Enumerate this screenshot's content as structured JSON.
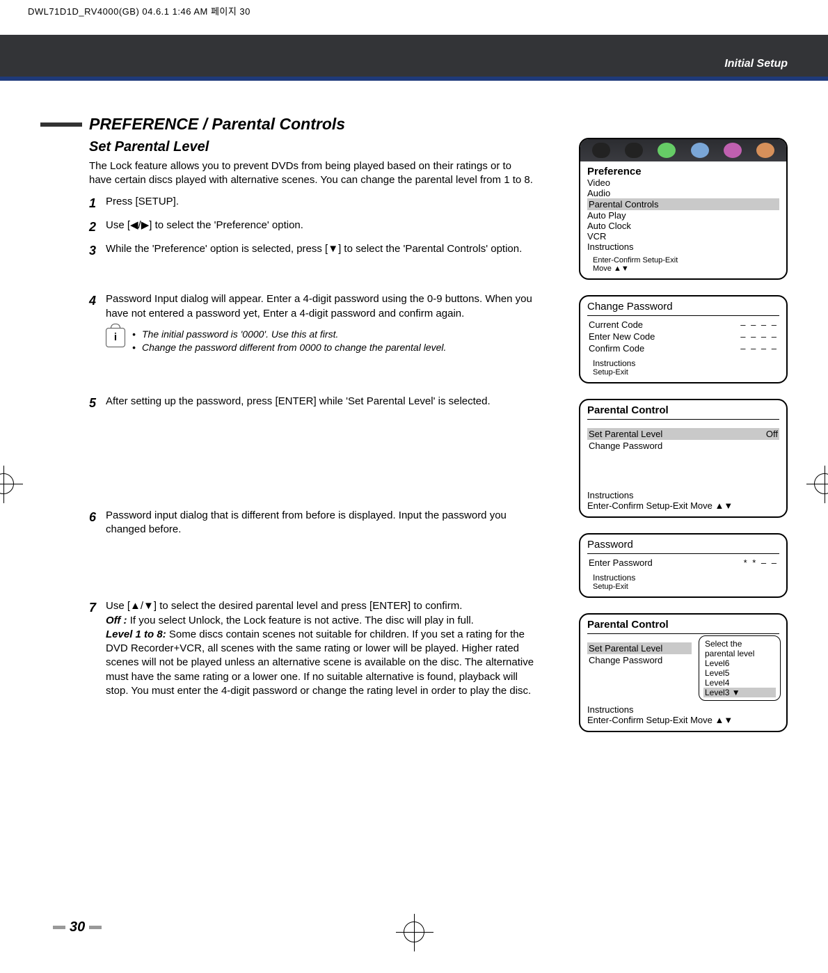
{
  "print_header": "DWL71D1D_RV4000(GB)   04.6.1  1:46 AM      페이지   30",
  "section_label": "Initial Setup",
  "heading": "PREFERENCE / Parental Controls",
  "sub_heading": "Set Parental Level",
  "intro": "The Lock feature allows you to prevent DVDs from being played based on their ratings or to have certain discs played with alternative scenes. You can change the parental level from 1 to 8.",
  "steps": {
    "s1": "Press [SETUP].",
    "s2": "Use [◀/▶] to select the 'Preference' option.",
    "s3": "While the 'Preference' option is selected, press [▼] to select the 'Parental Controls' option.",
    "s4": "Password Input dialog will appear. Enter a 4-digit password using the 0-9 buttons. When you have not entered a password yet, Enter a 4-digit password and confirm again.",
    "s5": "After setting up the password, press [ENTER] while 'Set Parental Level' is selected.",
    "s6": "Password input dialog that is different from before is displayed.  Input the password you changed before.",
    "s7_intro": "Use [▲/▼] to select the desired parental level and press [ENTER] to confirm.",
    "s7_off_label": "Off :",
    "s7_off": " If you select Unlock, the Lock feature is not active. The disc will play in full.",
    "s7_lvl_label": "Level 1 to 8:",
    "s7_lvl": " Some discs contain scenes not suitable for children. If you set a rating for the DVD Recorder+VCR, all scenes with the same rating or lower will be played. Higher rated scenes will not be played unless an alternative scene is available on the disc. The alternative must have the same rating or a lower one. If no suitable alternative is found, playback will stop. You must enter the 4-digit password or change the rating level in order to play the disc."
  },
  "notes": {
    "n1": "The initial password is '0000'. Use this at first.",
    "n2": "Change the password different from 0000 to change the parental level."
  },
  "osd": {
    "pref": {
      "title": "Preference",
      "items": [
        "Video",
        "Audio",
        "Parental Controls",
        "Auto Play",
        "Auto Clock",
        "VCR",
        "Instructions"
      ],
      "foot1": "Enter-Confirm   Setup-Exit",
      "foot2": "Move ▲▼"
    },
    "chpw": {
      "title": "Change Password",
      "r1": "Current Code",
      "r2": "Enter New Code",
      "r3": "Confirm Code",
      "dashes": "– – – –",
      "foot1": "Instructions",
      "foot2": "Setup-Exit"
    },
    "pc1": {
      "title": "Parental Control",
      "r1": "Set Parental Level",
      "r1v": "Off",
      "r2": "Change Password",
      "foot1": "Instructions",
      "foot2": "Enter-Confirm  Setup-Exit  Move ▲▼"
    },
    "pw": {
      "title": "Password",
      "r1": "Enter Password",
      "val": "* * – –",
      "foot1": "Instructions",
      "foot2": "Setup-Exit"
    },
    "pc2": {
      "title": "Parental Control",
      "r1": "Set Parental Level",
      "r2": "Change Password",
      "popup": [
        "Select the",
        "parental level",
        "Level6",
        "Level5",
        "Level4",
        "Level3 ▼"
      ],
      "foot1": "Instructions",
      "foot2": "Enter-Confirm  Setup-Exit  Move ▲▼"
    }
  },
  "page_number": "30"
}
